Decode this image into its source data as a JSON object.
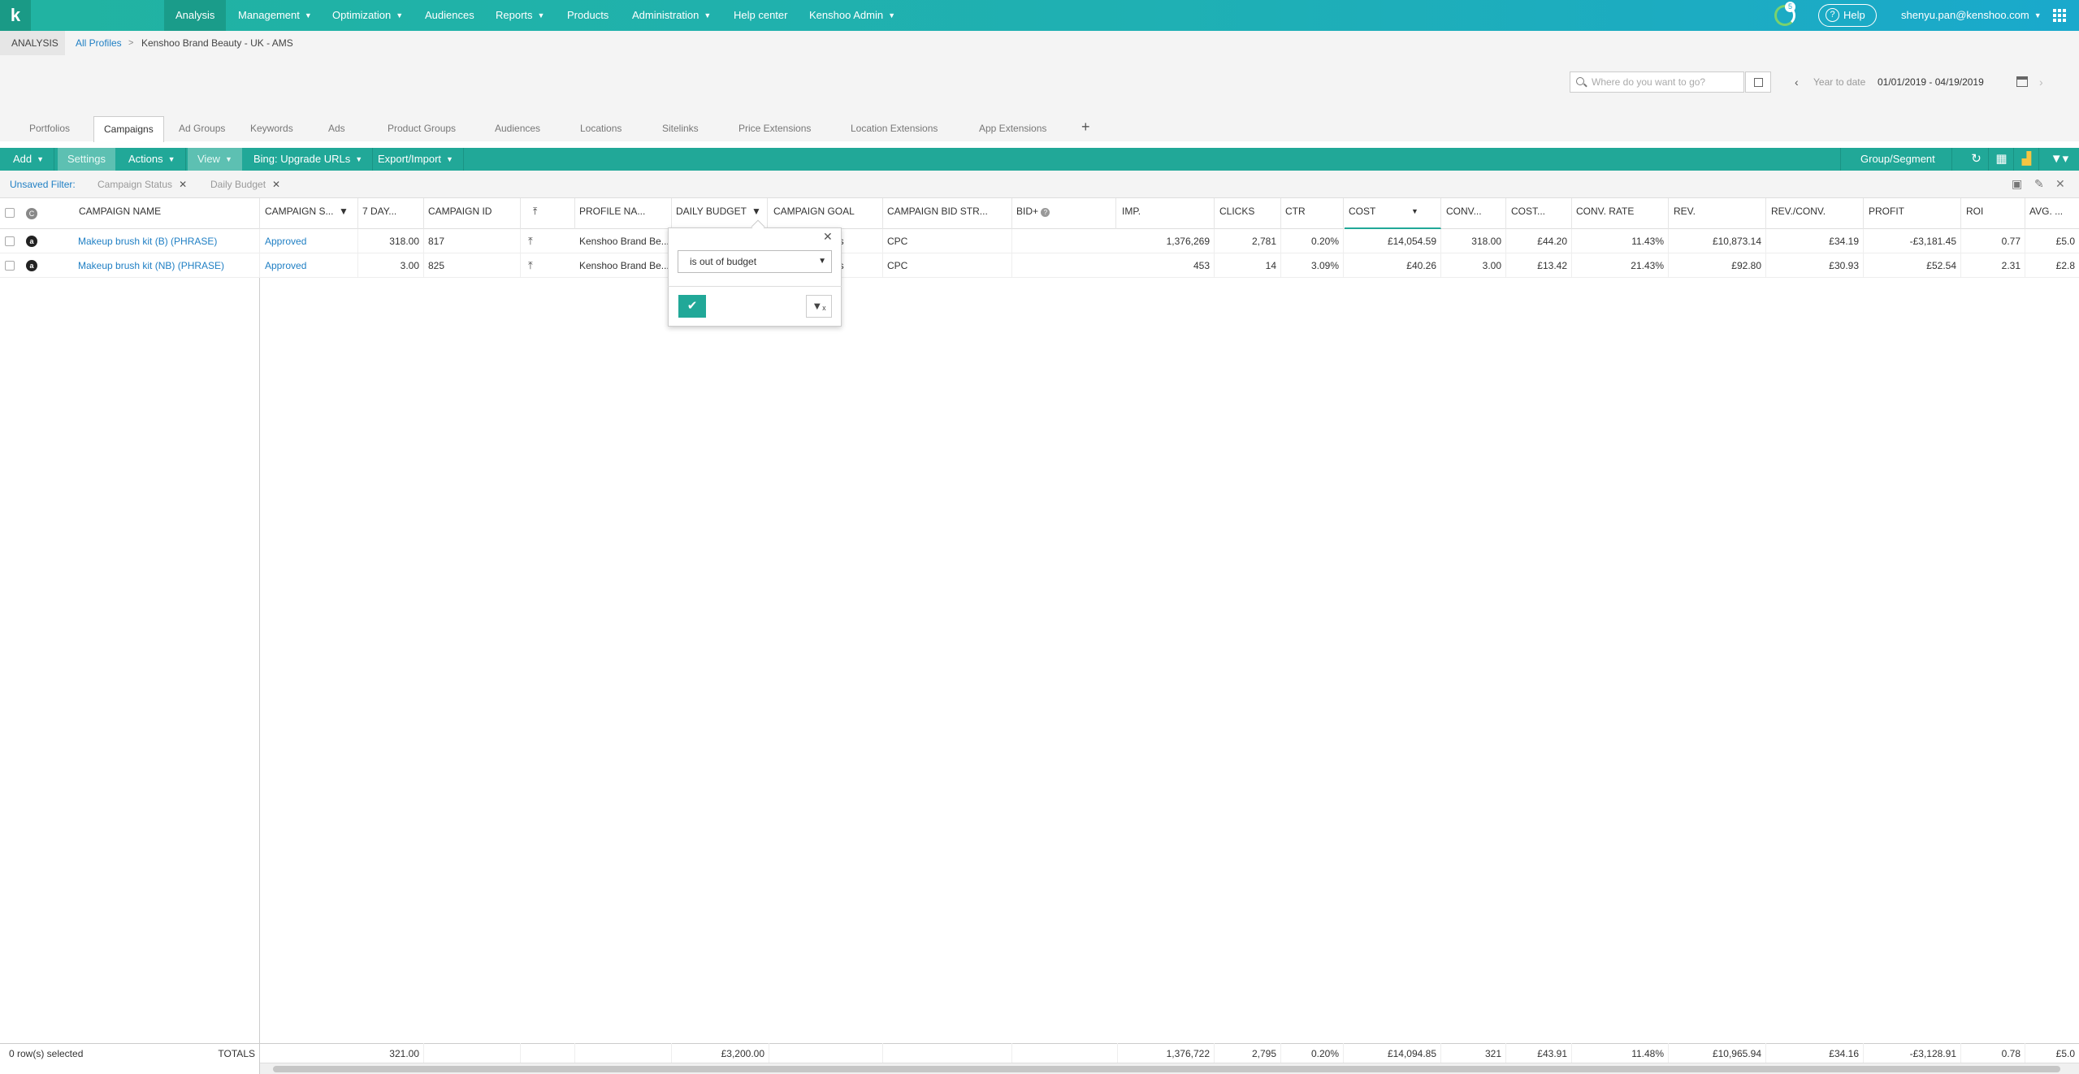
{
  "nav": {
    "logo": "k",
    "items": [
      {
        "label": "Analysis",
        "dropdown": false,
        "active": true
      },
      {
        "label": "Management",
        "dropdown": true
      },
      {
        "label": "Optimization",
        "dropdown": true
      },
      {
        "label": "Audiences",
        "dropdown": false
      },
      {
        "label": "Reports",
        "dropdown": true
      },
      {
        "label": "Products",
        "dropdown": false
      },
      {
        "label": "Administration",
        "dropdown": true
      },
      {
        "label": "Help center",
        "dropdown": false
      },
      {
        "label": "Kenshoo Admin",
        "dropdown": true
      }
    ],
    "notification_count": "5",
    "help_label": "Help",
    "user": "shenyu.pan@kenshoo.com"
  },
  "breadcrumb": {
    "section": "ANALYSIS",
    "link": "All Profiles",
    "separator": ">",
    "current": "Kenshoo Brand Beauty - UK - AMS"
  },
  "search": {
    "placeholder": "Where do you want to go?"
  },
  "date": {
    "label": "Year to date",
    "range": "01/01/2019 - 04/19/2019"
  },
  "tabs": [
    "Portfolios",
    "Campaigns",
    "Ad Groups",
    "Keywords",
    "Ads",
    "Product Groups",
    "Audiences",
    "Locations",
    "Sitelinks",
    "Price Extensions",
    "Location Extensions",
    "App Extensions"
  ],
  "active_tab": "Campaigns",
  "toolbar": {
    "add": "Add",
    "settings": "Settings",
    "actions": "Actions",
    "view": "View",
    "bing": "Bing: Upgrade URLs",
    "export": "Export/Import",
    "group_segment": "Group/Segment"
  },
  "filter": {
    "label": "Unsaved Filter:",
    "chips": [
      "Campaign Status",
      "Daily Budget"
    ]
  },
  "columns": {
    "campaign_name": "CAMPAIGN NAME",
    "campaign_status": "CAMPAIGN S...",
    "seven_day": "7 DAY...",
    "campaign_id": "CAMPAIGN ID",
    "profile_name": "PROFILE NA...",
    "daily_budget": "DAILY BUDGET",
    "campaign_goal": "CAMPAIGN GOAL",
    "bid_strategy": "CAMPAIGN BID STR...",
    "bid_plus": "BID+",
    "imp": "IMP.",
    "clicks": "CLICKS",
    "ctr": "CTR",
    "cost": "COST",
    "conv": "CONV...",
    "cost_per": "COST...",
    "conv_rate": "CONV. RATE",
    "rev": "REV.",
    "rev_conv": "REV./CONV.",
    "profit": "PROFIT",
    "roi": "ROI",
    "avg": "AVG. ..."
  },
  "rows": [
    {
      "name": "Makeup brush kit (B) (PHRASE)",
      "status": "Approved",
      "seven_day": "318.00",
      "id": "817",
      "profile": "Kenshoo Brand Be...",
      "goal": "ducts",
      "bid": "CPC",
      "imp": "1,376,269",
      "clicks": "2,781",
      "ctr": "0.20%",
      "cost": "£14,054.59",
      "conv": "318.00",
      "cost_per": "£44.20",
      "conv_rate": "11.43%",
      "rev": "£10,873.14",
      "rev_conv": "£34.19",
      "profit": "-£3,181.45",
      "roi": "0.77",
      "avg": "£5.0"
    },
    {
      "name": "Makeup brush kit (NB) (PHRASE)",
      "status": "Approved",
      "seven_day": "3.00",
      "id": "825",
      "profile": "Kenshoo Brand Be...",
      "goal": "ducts",
      "bid": "CPC",
      "imp": "453",
      "clicks": "14",
      "ctr": "3.09%",
      "cost": "£40.26",
      "conv": "3.00",
      "cost_per": "£13.42",
      "conv_rate": "21.43%",
      "rev": "£92.80",
      "rev_conv": "£30.93",
      "profit": "£52.54",
      "roi": "2.31",
      "avg": "£2.8"
    }
  ],
  "totals": {
    "selected": "0 row(s) selected",
    "label": "TOTALS",
    "seven_day": "321.00",
    "daily_budget": "£3,200.00",
    "imp": "1,376,722",
    "clicks": "2,795",
    "ctr": "0.20%",
    "cost": "£14,094.85",
    "conv": "321",
    "cost_per": "£43.91",
    "conv_rate": "11.48%",
    "rev": "£10,965.94",
    "rev_conv": "£34.16",
    "profit": "-£3,128.91",
    "roi": "0.78",
    "avg": "£5.0"
  },
  "popover": {
    "select_value": "is out of budget"
  }
}
